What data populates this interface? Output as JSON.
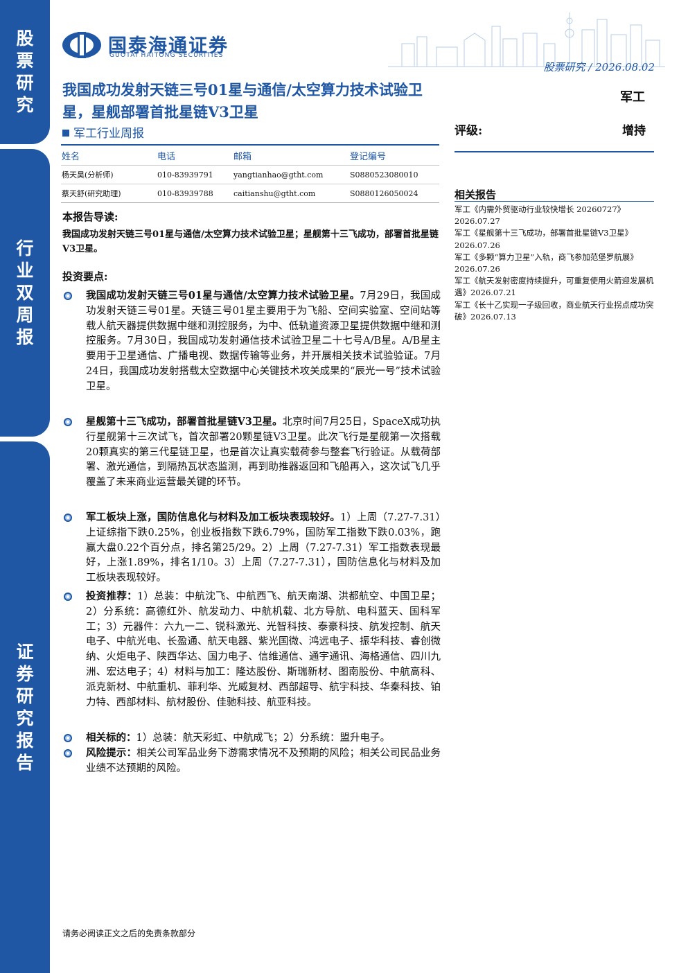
{
  "side_tabs": [
    "股票研究",
    "行业双周报",
    "证券研究报告"
  ],
  "brand": {
    "name_cn": "国泰海通证券",
    "name_en": "GUOTAI HAITONG SECURITIES"
  },
  "dateline": "股票研究 / 2026.08.02",
  "title": "我国成功发射天链三号01星与通信/太空算力技术试验卫星，星舰部署首批星链V3卫星",
  "subtitle": "军工行业周报",
  "industry": "军工",
  "rating": {
    "label": "评级:",
    "value": "增持"
  },
  "analysts": {
    "headers": [
      "姓名",
      "电话",
      "邮箱",
      "登记编号"
    ],
    "rows": [
      [
        "杨天昊(分析师)",
        "010-83939791",
        "yangtianhao@gtht.com",
        "S0880523080010"
      ],
      [
        "蔡天舒(研究助理)",
        "010-83939788",
        "caitianshu@gtht.com",
        "S0880126050024"
      ]
    ]
  },
  "related": {
    "heading": "相关报告",
    "items": [
      "军工《内需外贸驱动行业较快增长 20260727》2026.07.27",
      "军工《星舰第十三飞成功，部署首批星链V3卫星》2026.07.26",
      "军工《多颗“算力卫星”入轨，商飞参加范堡罗航展》2026.07.26",
      "军工《航天发射密度持续提升，可重复使用火箭迎发展机遇》2026.07.21",
      "军工《长十乙实现一子级回收，商业航天行业拐点成功突破》2026.07.13"
    ]
  },
  "guide": {
    "heading": "本报告导读:",
    "text": "我国成功发射天链三号01星与通信/太空算力技术试验卫星；星舰第十三飞成功，部署首批星链V3卫星。"
  },
  "key_points": {
    "heading": "投资要点:",
    "items": [
      {
        "lead": "我国成功发射天链三号01星与通信/太空算力技术试验卫星。",
        "text": "7月29日，我国成功发射天链三号01星。天链三号01星主要用于为飞船、空间实验室、空间站等载人航天器提供数据中继和测控服务，为中、低轨道资源卫星提供数据中继和测控服务。7月30日，我国成功发射通信技术试验卫星二十七号A/B星。A/B星主要用于卫星通信、广播电视、数据传输等业务，并开展相关技术试验验证。7月24日，我国成功发射搭载太空数据中心关键技术攻关成果的“辰光一号”技术试验卫星。"
      },
      {
        "lead": "星舰第十三飞成功，部署首批星链V3卫星。",
        "text": "北京时间7月25日，SpaceX成功执行星舰第十三次试飞，首次部署20颗星链V3卫星。此次飞行是星舰第一次搭载20颗真实的第三代星链卫星，也是首次让真实载荷参与整套飞行验证。从载荷部署、激光通信，到隔热瓦状态监测，再到助推器返回和飞船再入，这次试飞几乎覆盖了未来商业运营最关键的环节。"
      },
      {
        "lead": "军工板块上涨，国防信息化与材料及加工板块表现较好。",
        "text": "1）上周（7.27-7.31）上证综指下跌0.25%，创业板指数下跌6.79%，国防军工指数下跌0.03%，跑赢大盘0.22个百分点，排名第25/29。2）上周（7.27-7.31）军工指数表现最好，上涨1.89%，排名1/10。3）上周（7.27-7.31），国防信息化与材料及加工板块表现较好。"
      },
      {
        "lead": "投资推荐：",
        "text": "1）总装：中航沈飞、中航西飞、航天南湖、洪都航空、中国卫星；2）分系统：高德红外、航发动力、中航机载、北方导航、电科蓝天、国科军工；3）元器件：六九一二、锐科激光、光智科技、泰豪科技、航发控制、航天电子、中航光电、长盈通、航天电器、紫光国微、鸿远电子、振华科技、睿创微纳、火炬电子、陕西华达、国力电子、信维通信、通宇通讯、海格通信、四川九洲、宏达电子；4）材料与加工：隆达股份、斯瑞新材、图南股份、中航高科、派克新材、中航重机、菲利华、光威复材、西部超导、航宇科技、华秦科技、铂力特、西部材料、航材股份、佳驰科技、航亚科技。"
      },
      {
        "lead": "相关标的：",
        "text": "1）总装：航天彩虹、中航成飞；2）分系统：盟升电子。"
      },
      {
        "lead": "风险提示：",
        "text": "相关公司军品业务下游需求情况不及预期的风险；相关公司民品业务业绩不达预期的风险。"
      }
    ]
  },
  "footer": "请务必阅读正文之后的免责条款部分",
  "colors": {
    "brand": "#1f57a4"
  }
}
